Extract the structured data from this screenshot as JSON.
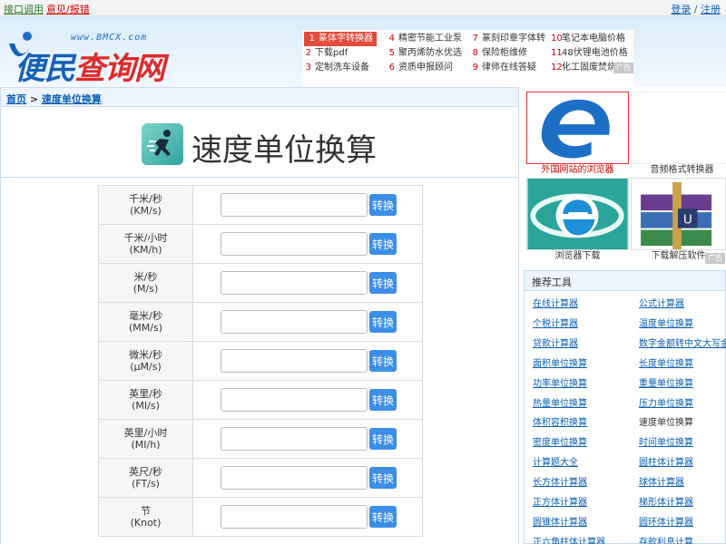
{
  "topbar": {
    "api": "接口调用",
    "feedback": "意见/报错",
    "login": "登录",
    "sep": " / ",
    "register": "注册"
  },
  "logo": {
    "url_text": "www.BMCX.com",
    "brand_blue": "便民",
    "brand_red": "查询网"
  },
  "hot_list": [
    {
      "num": "1",
      "label": "篆体字转换器",
      "active": true
    },
    {
      "num": "2",
      "label": "下载pdf"
    },
    {
      "num": "3",
      "label": "定制洗车设备"
    },
    {
      "num": "4",
      "label": "精密节能工业泵"
    },
    {
      "num": "5",
      "label": "聚丙烯防水优选"
    },
    {
      "num": "6",
      "label": "资质申报顾问"
    },
    {
      "num": "7",
      "label": "篆刻印章字体转"
    },
    {
      "num": "8",
      "label": "保险柜维修"
    },
    {
      "num": "9",
      "label": "律师在线答疑"
    },
    {
      "num": "10",
      "label": "笔记本电脑价格"
    },
    {
      "num": "11",
      "label": "48伏锂电池价格"
    },
    {
      "num": "12",
      "label": "化工固废焚烧炉"
    }
  ],
  "ad_chip": "广告",
  "breadcrumb": {
    "home": "首页",
    "sep": " > ",
    "current": "速度单位换算"
  },
  "page_title": "速度单位换算",
  "units": [
    {
      "name": "千米/秒",
      "abbr": "(KM/s)"
    },
    {
      "name": "千米/小时",
      "abbr": "(KM/h)"
    },
    {
      "name": "米/秒",
      "abbr": "(M/s)"
    },
    {
      "name": "毫米/秒",
      "abbr": "(MM/s)"
    },
    {
      "name": "微米/秒",
      "abbr": "(µM/s)"
    },
    {
      "name": "英里/秒",
      "abbr": "(MI/s)"
    },
    {
      "name": "英里/小时",
      "abbr": "(MI/h)"
    },
    {
      "name": "英尺/秒",
      "abbr": "(FT/s)"
    },
    {
      "name": "节",
      "abbr": "(Knot)"
    }
  ],
  "convert_label": "转换",
  "ads": [
    {
      "caption": "外国网站的浏览器",
      "icon": "edge-logo-icon"
    },
    {
      "caption": "音频格式转换器",
      "icon": "audio-icon"
    },
    {
      "caption": "浏览器下载",
      "icon": "ie-logo-icon"
    },
    {
      "caption": "下载解压软件",
      "icon": "winrar-icon"
    }
  ],
  "recommend": {
    "title": "推荐工具",
    "items": [
      "在线计算器",
      "公式计算器",
      "个税计算器",
      "温度单位换算",
      "贷款计算器",
      "数字金额转中文大写金额",
      "面积单位换算",
      "长度单位换算",
      "功率单位换算",
      "重量单位换算",
      "热量单位换算",
      "压力单位换算",
      "体积容积换算",
      "速度单位换算",
      "密度单位换算",
      "时间单位换算",
      "计算题大全",
      "圆柱体计算器",
      "长方体计算器",
      "球体计算器",
      "正方体计算器",
      "梯形体计算器",
      "圆锥体计算器",
      "圆环体计算器",
      "正六角柱体计算器",
      "存款利息计算"
    ],
    "current_index": 13
  },
  "colors": {
    "accent": "#3c8ee8",
    "link": "#0a5fb4",
    "highlight": "#e34b3a"
  }
}
